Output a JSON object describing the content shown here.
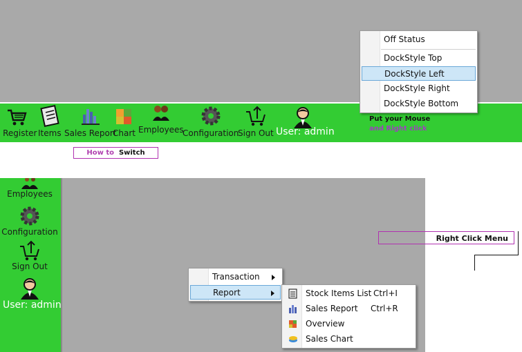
{
  "top_toolbar": {
    "items": [
      {
        "label": "s Register",
        "icon": "cart-icon"
      },
      {
        "label": "Items",
        "icon": "notepad-icon"
      },
      {
        "label": "Sales Report",
        "icon": "report-chart-icon"
      },
      {
        "label": "Chart",
        "icon": "chart-icon"
      },
      {
        "label": "Employees",
        "icon": "employees-icon"
      },
      {
        "label": "Configuration",
        "icon": "gear-icon"
      },
      {
        "label": "Sign Out",
        "icon": "cart-arrow-icon"
      }
    ],
    "user_label": "User: admin",
    "hint_line1": "Put your Mouse",
    "hint_line2": "and Right click"
  },
  "dock_menu": {
    "items": [
      "Off Status",
      "DockStyle Top",
      "DockStyle Left",
      "DockStyle Right",
      "DockStyle Bottom"
    ],
    "selected": "DockStyle Left"
  },
  "switch_label": {
    "part1": "How to",
    "part2": "Switch"
  },
  "side_toolbar": {
    "items": [
      {
        "label": "Employees",
        "icon": "employees-icon"
      },
      {
        "label": "Configuration",
        "icon": "gear-icon"
      },
      {
        "label": "Sign Out",
        "icon": "cart-arrow-icon"
      }
    ],
    "user_label": "User: admin"
  },
  "right_click_label": "Right Click Menu",
  "context_menu": {
    "items": [
      "Transaction",
      "Report"
    ],
    "selected": "Report"
  },
  "report_submenu": {
    "items": [
      {
        "label": "Stock Items List",
        "shortcut": "Ctrl+I",
        "icon": "list-icon"
      },
      {
        "label": "Sales Report",
        "shortcut": "Ctrl+R",
        "icon": "report-chart-icon"
      },
      {
        "label": "Overview",
        "shortcut": "",
        "icon": "overview-icon"
      },
      {
        "label": "Sales Chart",
        "shortcut": "",
        "icon": "sales-chart-icon"
      }
    ]
  }
}
